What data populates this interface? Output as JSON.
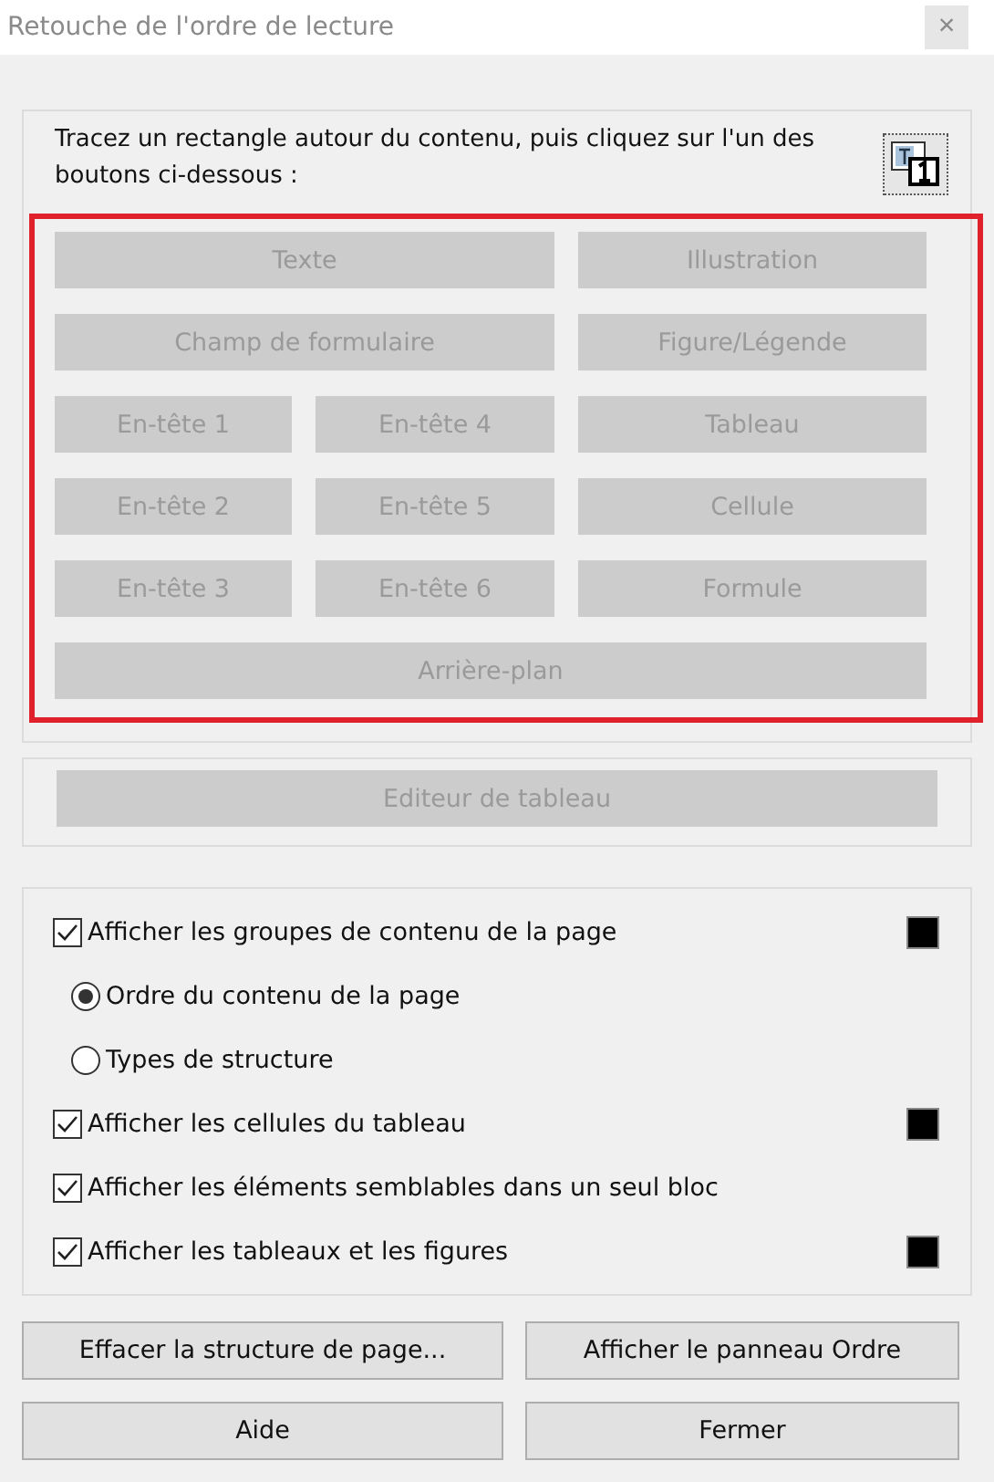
{
  "window": {
    "title": "Retouche de l'ordre de lecture",
    "close": {
      "label": "×",
      "disabled": true
    }
  },
  "instructions": "Tracez un rectangle autour du contenu, puis cliquez sur l'un des boutons ci-dessous :",
  "tag_buttons": [
    {
      "label": "Texte",
      "kind": "wide",
      "disabled": true
    },
    {
      "label": "Illustration",
      "kind": "side",
      "disabled": true
    },
    {
      "label": "Champ de formulaire",
      "kind": "wide",
      "disabled": true
    },
    {
      "label": "Figure/Légende",
      "kind": "side",
      "disabled": true
    },
    {
      "label": "En-tête 1",
      "kind": "half",
      "disabled": true
    },
    {
      "label": "En-tête 4",
      "kind": "half",
      "disabled": true
    },
    {
      "label": "Tableau",
      "kind": "side",
      "disabled": true
    },
    {
      "label": "En-tête 2",
      "kind": "half",
      "disabled": true
    },
    {
      "label": "En-tête 5",
      "kind": "half",
      "disabled": true
    },
    {
      "label": "Cellule",
      "kind": "side",
      "disabled": true
    },
    {
      "label": "En-tête 3",
      "kind": "half",
      "disabled": true
    },
    {
      "label": "En-tête 6",
      "kind": "half",
      "disabled": true
    },
    {
      "label": "Formule",
      "kind": "side",
      "disabled": true
    },
    {
      "label": "Arrière-plan",
      "kind": "full",
      "disabled": true
    }
  ],
  "table_editor": {
    "label": "Editeur de tableau",
    "disabled": true
  },
  "options": [
    {
      "kind": "checkbox",
      "label": "Afficher les groupes de contenu de la page",
      "checked": true,
      "color": "#000000"
    },
    {
      "kind": "radio",
      "label": "Ordre du contenu de la page",
      "selected": true
    },
    {
      "kind": "radio",
      "label": "Types de structure",
      "selected": false
    },
    {
      "kind": "checkbox",
      "label": "Afficher les cellules du tableau",
      "checked": true,
      "color": "#000000"
    },
    {
      "kind": "checkbox",
      "label": "Afficher les éléments semblables dans un seul bloc",
      "checked": true
    },
    {
      "kind": "checkbox",
      "label": "Afficher les tableaux et les figures",
      "checked": true,
      "color": "#000000"
    }
  ],
  "buttons": [
    "Effacer la structure de page...",
    "Afficher le panneau Ordre",
    "Aide",
    "Fermer"
  ]
}
